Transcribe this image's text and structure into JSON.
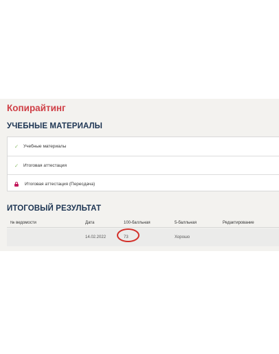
{
  "course": {
    "title": "Копирайтинг"
  },
  "materials": {
    "heading": "УЧЕБНЫЕ МАТЕРИАЛЫ",
    "items": [
      {
        "label": "Учебные материалы",
        "icon": "check-icon",
        "status": "done"
      },
      {
        "label": "Итоговая аттестация",
        "icon": "check-icon",
        "status": "done"
      },
      {
        "label": "Итоговая аттестация (Пересдача)",
        "icon": "lock-icon",
        "status": "locked"
      }
    ]
  },
  "results": {
    "heading": "ИТОГОВЫЙ РЕЗУЛЬТАТ",
    "columns": {
      "number": "№ ведомости",
      "date": "Дата",
      "score100": "100-балльная",
      "score5": "5-балльная",
      "edit": "Редактирование"
    },
    "rows": [
      {
        "number": "",
        "date": "14.02.2022",
        "score100": "73",
        "score5": "Хорошо",
        "edit": ""
      }
    ]
  },
  "colors": {
    "course_title": "#cf3e45",
    "heading": "#1d3553",
    "check": "#8dbd6a",
    "lock": "#c2185b",
    "highlight": "#d3302a"
  }
}
